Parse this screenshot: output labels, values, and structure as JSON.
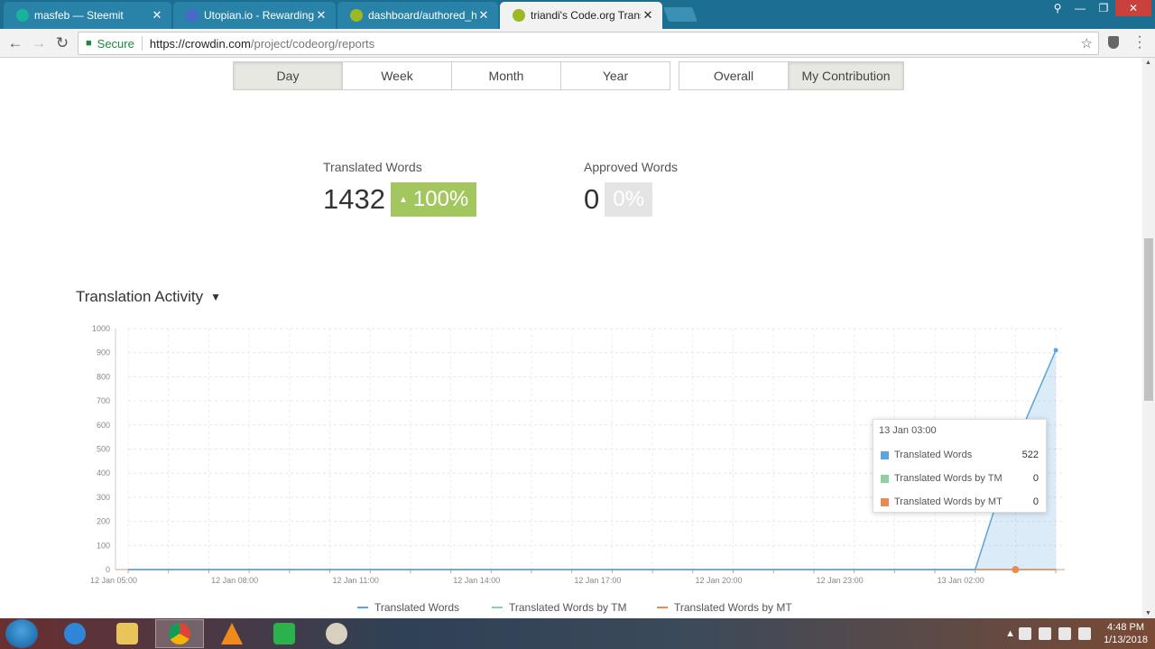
{
  "browser": {
    "tabs": [
      {
        "title": "masfeb — Steemit",
        "color": "#18b39a"
      },
      {
        "title": "Utopian.io - Rewarding C",
        "color": "#4a68c8"
      },
      {
        "title": "dashboard/authored_hin",
        "color": "#9ab923"
      },
      {
        "title": "triandi's Code.org Transl",
        "color": "#9ab923"
      }
    ],
    "active_tab": 3,
    "address": {
      "secure_label": "Secure",
      "url_host": "https://crowdin.com",
      "url_path": "/project/codeorg/reports"
    }
  },
  "period_tabs": [
    {
      "label": "Day",
      "active": true
    },
    {
      "label": "Week",
      "active": false
    },
    {
      "label": "Month",
      "active": false
    },
    {
      "label": "Year",
      "active": false
    }
  ],
  "scope_tabs": [
    {
      "label": "Overall",
      "active": false
    },
    {
      "label": "My Contribution",
      "active": true
    }
  ],
  "stats": {
    "translated": {
      "label": "Translated Words",
      "value": "1432",
      "change": "100%"
    },
    "approved": {
      "label": "Approved Words",
      "value": "0",
      "change": "0%"
    }
  },
  "section": {
    "title": "Translation Activity"
  },
  "chart_data": {
    "type": "area",
    "y_ticks": [
      "0",
      "100",
      "200",
      "300",
      "400",
      "500",
      "600",
      "700",
      "800",
      "900",
      "1000"
    ],
    "ylim": [
      0,
      1000
    ],
    "x_ticks": [
      "12 Jan 05:00",
      "12 Jan 08:00",
      "12 Jan 11:00",
      "12 Jan 14:00",
      "12 Jan 17:00",
      "12 Jan 20:00",
      "12 Jan 23:00",
      "13 Jan 02:00"
    ],
    "x_hours": [
      "12 Jan 05:00",
      "12 Jan 06:00",
      "12 Jan 07:00",
      "12 Jan 08:00",
      "12 Jan 09:00",
      "12 Jan 10:00",
      "12 Jan 11:00",
      "12 Jan 12:00",
      "12 Jan 13:00",
      "12 Jan 14:00",
      "12 Jan 15:00",
      "12 Jan 16:00",
      "12 Jan 17:00",
      "12 Jan 18:00",
      "12 Jan 19:00",
      "12 Jan 20:00",
      "12 Jan 21:00",
      "12 Jan 22:00",
      "12 Jan 23:00",
      "13 Jan 00:00",
      "13 Jan 01:00",
      "13 Jan 02:00",
      "13 Jan 03:00",
      "13 Jan 04:00"
    ],
    "series": [
      {
        "name": "Translated Words",
        "color": "#5aa5dc",
        "values": [
          0,
          0,
          0,
          0,
          0,
          0,
          0,
          0,
          0,
          0,
          0,
          0,
          0,
          0,
          0,
          0,
          0,
          0,
          0,
          0,
          0,
          0,
          522,
          910
        ]
      },
      {
        "name": "Translated Words by TM",
        "color": "#8fcfa0",
        "values": [
          0,
          0,
          0,
          0,
          0,
          0,
          0,
          0,
          0,
          0,
          0,
          0,
          0,
          0,
          0,
          0,
          0,
          0,
          0,
          0,
          0,
          0,
          0,
          0
        ]
      },
      {
        "name": "Translated Words by MT",
        "color": "#e98a52",
        "values": [
          0,
          0,
          0,
          0,
          0,
          0,
          0,
          0,
          0,
          0,
          0,
          0,
          0,
          0,
          0,
          0,
          0,
          0,
          0,
          0,
          0,
          0,
          0,
          0
        ]
      }
    ],
    "tooltip": {
      "title": "13 Jan 03:00",
      "rows": [
        {
          "name": "Translated Words",
          "value": "522",
          "color": "#5aa5dc"
        },
        {
          "name": "Translated Words by TM",
          "value": "0",
          "color": "#8fcfa0"
        },
        {
          "name": "Translated Words by MT",
          "value": "0",
          "color": "#e98a52"
        }
      ]
    },
    "grid": true,
    "legend_position": "bottom"
  },
  "taskbar": {
    "time": "4:48 PM",
    "date": "1/13/2018"
  }
}
